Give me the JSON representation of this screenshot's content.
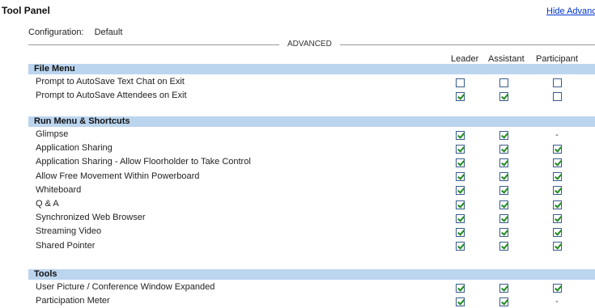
{
  "panel": {
    "title": "Tool Panel",
    "hide_link": "Hide Advanced"
  },
  "config": {
    "label": "Configuration:",
    "value": "Default"
  },
  "advanced_label": "ADVANCED",
  "columns": [
    "Leader",
    "Assistant",
    "Participant"
  ],
  "sections": [
    {
      "title": "File Menu",
      "rows": [
        {
          "label": "Prompt to AutoSave Text Chat on Exit",
          "values": [
            "off",
            "off",
            "off"
          ]
        },
        {
          "label": "Prompt to AutoSave Attendees on Exit",
          "values": [
            "on",
            "on",
            "off"
          ]
        }
      ]
    },
    {
      "title": "Run Menu & Shortcuts",
      "rows": [
        {
          "label": "Glimpse",
          "values": [
            "on",
            "on",
            "-"
          ]
        },
        {
          "label": "Application Sharing",
          "values": [
            "on",
            "on",
            "on"
          ]
        },
        {
          "label": "Application Sharing - Allow Floorholder to Take Control",
          "values": [
            "on",
            "on",
            "on"
          ]
        },
        {
          "label": "Allow Free Movement Within Powerboard",
          "values": [
            "on",
            "on",
            "on"
          ]
        },
        {
          "label": "Whiteboard",
          "values": [
            "on",
            "on",
            "on"
          ]
        },
        {
          "label": "Q & A",
          "values": [
            "on",
            "on",
            "on"
          ]
        },
        {
          "label": "Synchronized Web Browser",
          "values": [
            "on",
            "on",
            "on"
          ]
        },
        {
          "label": "Streaming Video",
          "values": [
            "on",
            "on",
            "on"
          ]
        },
        {
          "label": "Shared Pointer",
          "values": [
            "on",
            "on",
            "on"
          ]
        }
      ]
    },
    {
      "title": "Tools",
      "rows": [
        {
          "label": "User Picture / Conference Window Expanded",
          "values": [
            "on",
            "on",
            "on"
          ]
        },
        {
          "label": "Participation Meter",
          "values": [
            "on",
            "on",
            "-"
          ]
        }
      ]
    }
  ]
}
